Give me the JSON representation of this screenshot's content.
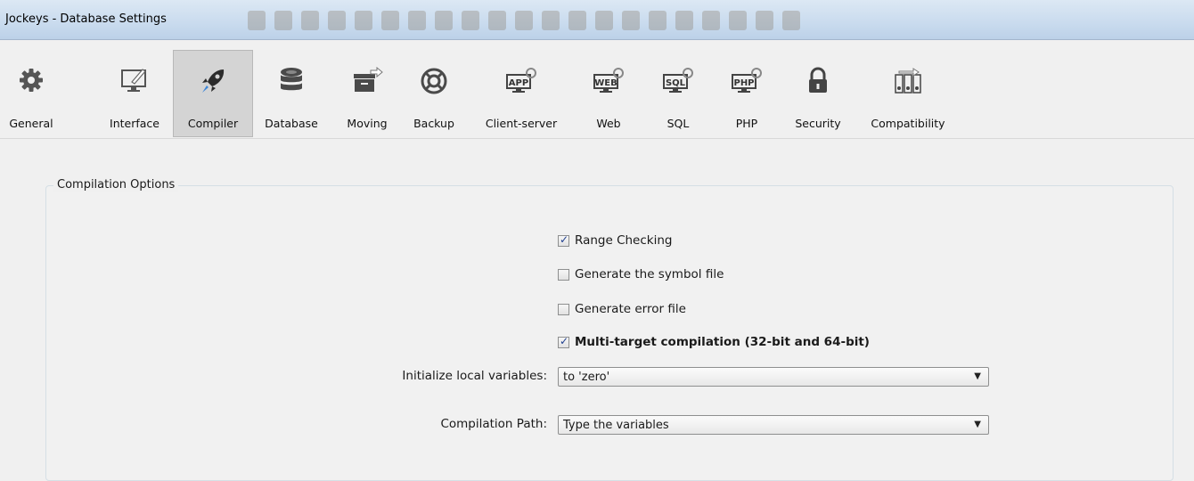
{
  "window": {
    "title": "Jockeys - Database Settings"
  },
  "toolbar": {
    "items": [
      {
        "label": "General",
        "icon": "gear-icon"
      },
      {
        "label": "Interface",
        "icon": "monitor-pencil-icon"
      },
      {
        "label": "Compiler",
        "icon": "rocket-icon",
        "active": true
      },
      {
        "label": "Database",
        "icon": "database-icon"
      },
      {
        "label": "Moving",
        "icon": "box-arrow-icon"
      },
      {
        "label": "Backup",
        "icon": "lifebuoy-icon"
      },
      {
        "label": "Client-server",
        "icon": "app-server-icon"
      },
      {
        "label": "Web",
        "icon": "web-server-icon"
      },
      {
        "label": "SQL",
        "icon": "sql-server-icon"
      },
      {
        "label": "PHP",
        "icon": "php-server-icon"
      },
      {
        "label": "Security",
        "icon": "lock-icon"
      },
      {
        "label": "Compatibility",
        "icon": "compatibility-icon"
      }
    ]
  },
  "compilation_options": {
    "title": "Compilation Options",
    "checkboxes": [
      {
        "label": "Range Checking",
        "checked": true
      },
      {
        "label": "Generate the symbol file",
        "checked": false
      },
      {
        "label": "Generate error file",
        "checked": false
      },
      {
        "label": "Multi-target compilation (32-bit and 64-bit)",
        "checked": true
      }
    ],
    "init_vars": {
      "label": "Initialize local variables:",
      "value": "to 'zero'"
    },
    "compilation_path": {
      "label": "Compilation Path:",
      "value": "Type the variables"
    }
  }
}
